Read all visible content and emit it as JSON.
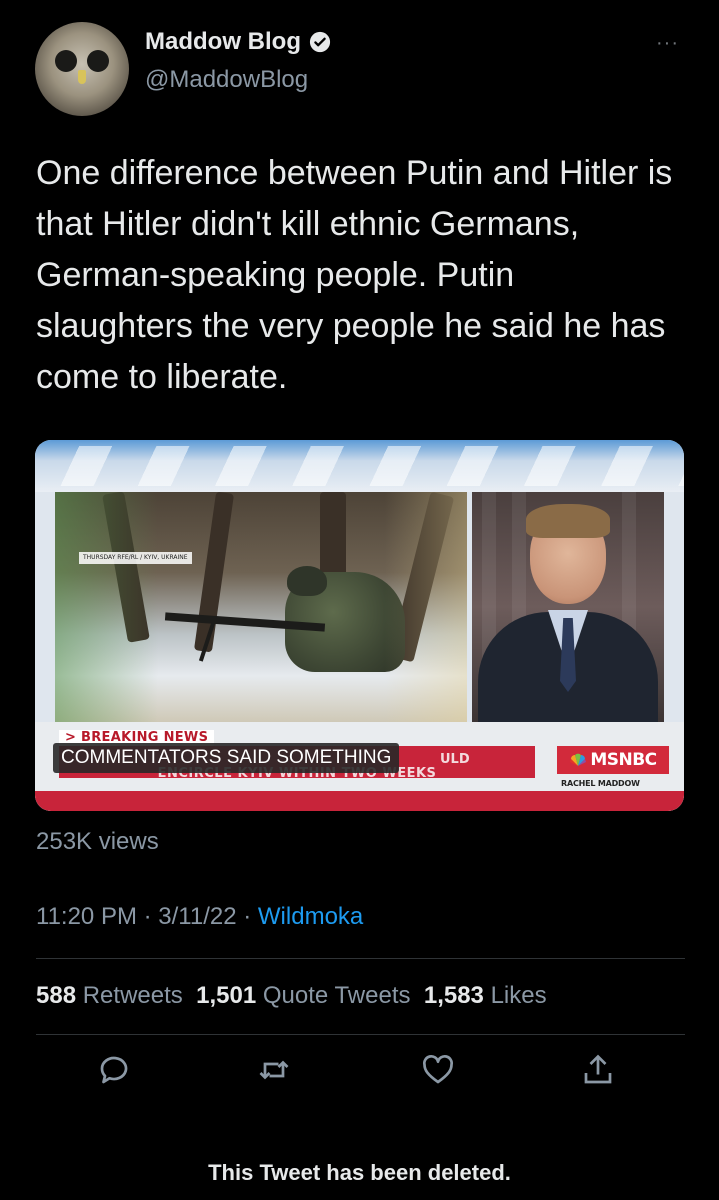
{
  "author": {
    "display_name": "Maddow Blog",
    "handle": "@MaddowBlog",
    "verified": true,
    "avatar_icon": "owl-avatar"
  },
  "more_label": "···",
  "tweet": {
    "text": "One difference between Putin and Hitler is that Hitler didn't kill ethnic Germans, German-speaking people. Putin slaughters the very people he said he has come to liberate."
  },
  "media": {
    "breaking_label": "> BREAKING NEWS",
    "headline_bottom": "ENCIRCLE KYIV WITHIN TWO WEEKS",
    "headline_fragment": "ULD",
    "caption_overlay": "COMMENTATORS SAID SOMETHING",
    "network": "MSNBC",
    "show": "RACHEL MADDOW",
    "video_tag": "THURSDAY RFE/RL / KYIV, UKRAINE"
  },
  "views": "253K views",
  "meta": {
    "time_date": "11:20 PM · 3/11/22 · ",
    "app": "Wildmoka"
  },
  "stats": {
    "retweets_count": "588",
    "retweets_label": "Retweets",
    "quotes_count": "1,501",
    "quotes_label": "Quote Tweets",
    "likes_count": "1,583",
    "likes_label": "Likes"
  },
  "actions": [
    "reply-icon",
    "retweet-icon",
    "like-icon",
    "share-icon"
  ],
  "deleted_notice": "This Tweet has been deleted.",
  "colors": {
    "background": "#000000",
    "text": "#e7e9ea",
    "muted": "#8b98a5",
    "link": "#1d9bf0",
    "msnbc_red": "#c8243a"
  }
}
